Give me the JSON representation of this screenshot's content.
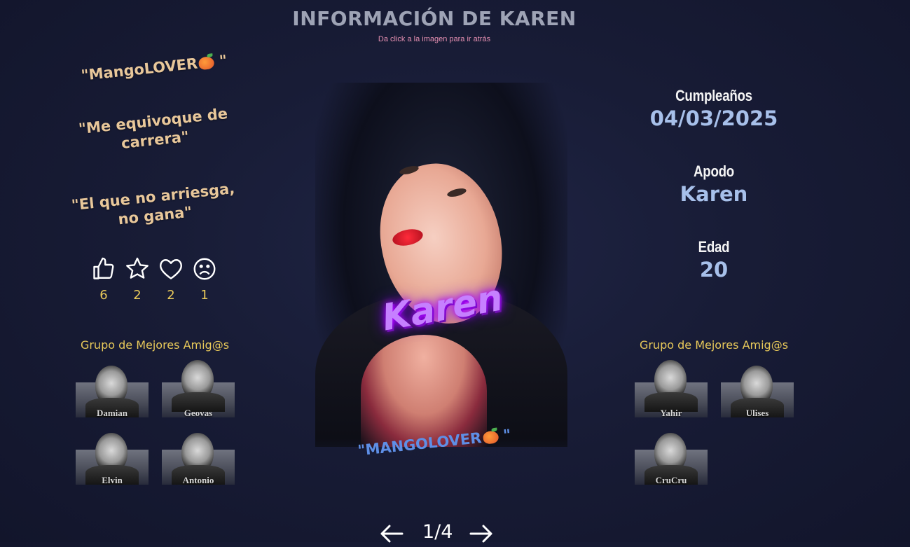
{
  "header": {
    "title": "INFORMACIÓN DE KAREN",
    "subtitle": "Da click a la imagen para ir atrás"
  },
  "quotes": [
    {
      "text": "\"MangoLOVER",
      "suffix": " \"",
      "has_mango": true
    },
    {
      "text": "\"Me equivoque de carrera\"",
      "suffix": "",
      "has_mango": false
    },
    {
      "text": "\"El que no arriesga, no gana\"",
      "suffix": "",
      "has_mango": false
    }
  ],
  "reactions": [
    {
      "icon": "thumbs-up-icon",
      "count": "6"
    },
    {
      "icon": "star-icon",
      "count": "2"
    },
    {
      "icon": "heart-icon",
      "count": "2"
    },
    {
      "icon": "sad-face-icon",
      "count": "1"
    }
  ],
  "left_group": {
    "title": "Grupo de Mejores Amig@s",
    "friends": [
      "Damian",
      "Geovas",
      "Elvin",
      "Antonio"
    ]
  },
  "right_group": {
    "title": "Grupo de Mejores Amig@s",
    "friends": [
      "Yahir",
      "Ulises",
      "CruCru"
    ]
  },
  "photo": {
    "name": "Karen",
    "caption": "\"MANGOLOVER",
    "caption_suffix": " \""
  },
  "info": {
    "birthday_label": "Cumpleaños",
    "birthday_value": "04/03/2025",
    "nickname_label": "Apodo",
    "nickname_value": "Karen",
    "age_label": "Edad",
    "age_value": "20"
  },
  "pager": {
    "page": "1/4",
    "prev_icon": "arrow-left-icon",
    "next_icon": "arrow-right-icon"
  },
  "colors": {
    "background": "#181c36",
    "quote": "#e8c79a",
    "count": "#e8c95a",
    "info_value": "#a7c0ea",
    "neon": "#c680ff",
    "caption": "#5e8fe6"
  }
}
